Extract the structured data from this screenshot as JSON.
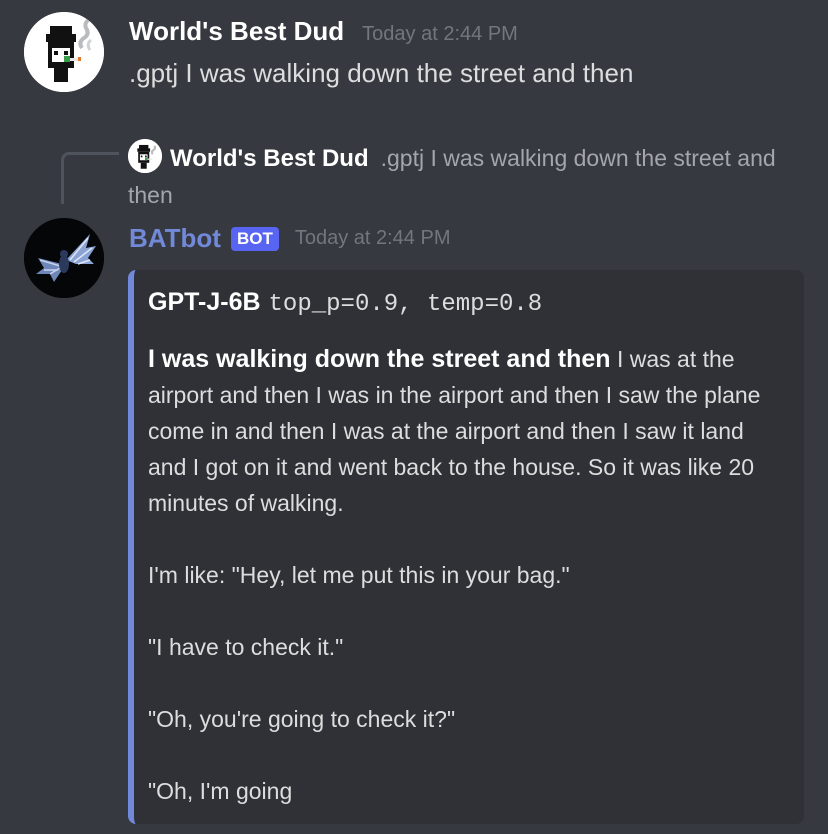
{
  "message_1": {
    "username": "World's Best Dud",
    "timestamp": "Today at 2:44 PM",
    "content": ".gptj I was walking down the street and then",
    "avatar_icon": "cartoon-person-smoking-avatar"
  },
  "reply_reference": {
    "username": "World's Best Dud",
    "content": ".gptj I was walking down the street and then",
    "avatar_icon": "cartoon-person-smoking-avatar"
  },
  "message_2": {
    "username": "BATbot",
    "bot_tag": "BOT",
    "timestamp": "Today at 2:44 PM",
    "avatar_icon": "bat-avatar",
    "embed": {
      "accent_color": "#7289da",
      "title_model": "GPT-J-6B",
      "title_params": "top_p=0.9, temp=0.8",
      "prompt": "I was walking down the street and then",
      "continuation": " I was at the airport and then I was in the airport and then I saw the plane come in and then I was at the airport and then I saw it land and I got on it and went back to the house. So it was like 20 minutes of walking.",
      "paragraphs": [
        "I'm like: \"Hey, let me put this in your bag.\"",
        "\"I have to check it.\"",
        "\"Oh, you're going to check it?\"",
        "\"Oh, I'm going"
      ]
    }
  },
  "colors": {
    "background": "#36393f",
    "embed_background": "#2f3136",
    "bot_name": "#7289da",
    "bot_tag": "#5865f2",
    "timestamp": "#72767d"
  }
}
